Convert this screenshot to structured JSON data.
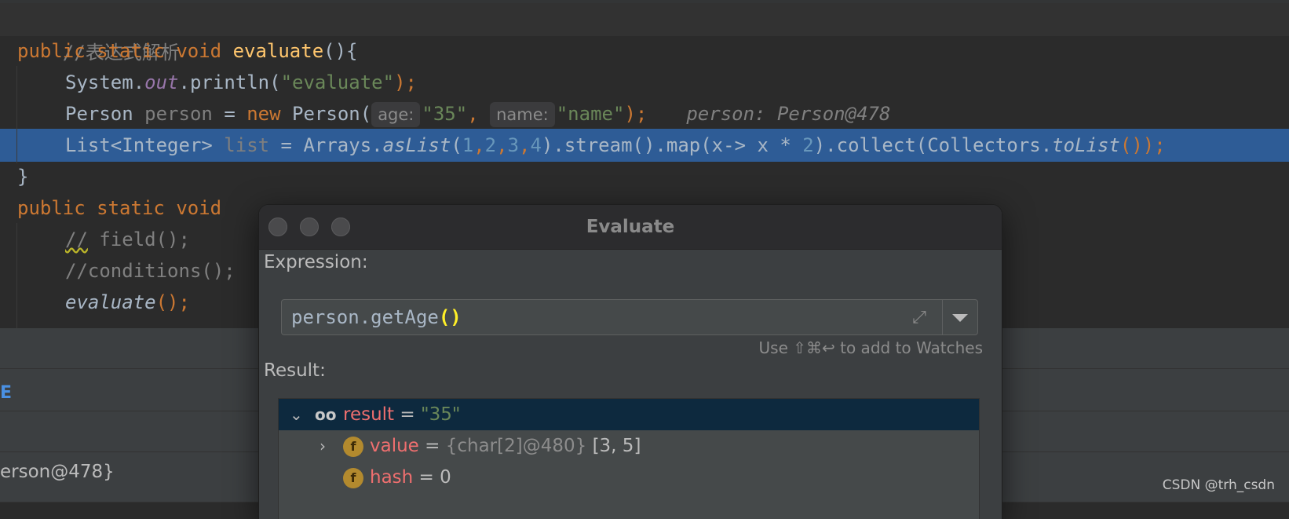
{
  "editor": {
    "comment_line": "//表达式解析",
    "line1": {
      "kw1": "public",
      "kw2": "static",
      "kw3": "void",
      "fn": "evaluate",
      "rest": "(){"
    },
    "line2": {
      "pre": "System.",
      "static": "out",
      "mid": ".println(",
      "str": "\"evaluate\"",
      "end": ");"
    },
    "line3": {
      "type": "Person",
      "var": "person",
      "eq": "=",
      "kw": "new",
      "call": "Person(",
      "hint1": "age:",
      "arg1": "\"35\"",
      "comma": ",",
      "hint2": "name:",
      "arg2": "\"name\"",
      "end": ");",
      "inline_value": "person: Person@478"
    },
    "line4": {
      "type": "List<Integer>",
      "var": "list",
      "eq": "=",
      "pre": "Arrays.",
      "call": "asList",
      "open": "(",
      "n1": "1",
      "n2": "2",
      "n3": "3",
      "n4": "4",
      "mid1": ").stream().map(x-> x * ",
      "n5": "2",
      "mid2": ").collect(Collectors.",
      "call2": "toList",
      "end": "());"
    },
    "line5": "}",
    "line6": {
      "kw1": "public",
      "kw2": "static",
      "kw3": "void"
    },
    "line7": {
      "cm1": "//",
      "rest": " field();"
    },
    "line8": "//conditions();",
    "line9": {
      "call": "evaluate",
      "end": "();"
    }
  },
  "panel": {
    "mark": "E",
    "value_text": "erson@478}",
    "watermark": "CSDN @trh_csdn"
  },
  "dialog": {
    "title": "Evaluate",
    "expression_label": "Expression:",
    "expression_text": "person.getAge",
    "expression_parens": "()",
    "watch_hint": "Use ⇧⌘↩ to add to Watches",
    "result_label": "Result:",
    "rows": [
      {
        "name": "result",
        "eq": " = ",
        "value": "\"35\""
      },
      {
        "name": "value",
        "eq": " = ",
        "dim": "{char[2]@480}",
        "value": " [3, 5]"
      },
      {
        "name": "hash",
        "eq": " = ",
        "value": "0"
      }
    ],
    "icons": {
      "field_letter": "f",
      "expand": "⤢",
      "glasses": "oo"
    }
  },
  "colors": {
    "editor_bg": "#2b2b2b",
    "selection": "#2e5c96",
    "keyword": "#cc7832",
    "function": "#ffc66d",
    "string": "#6a8759",
    "number": "#6897bb",
    "field_name": "#ef6f6f"
  }
}
